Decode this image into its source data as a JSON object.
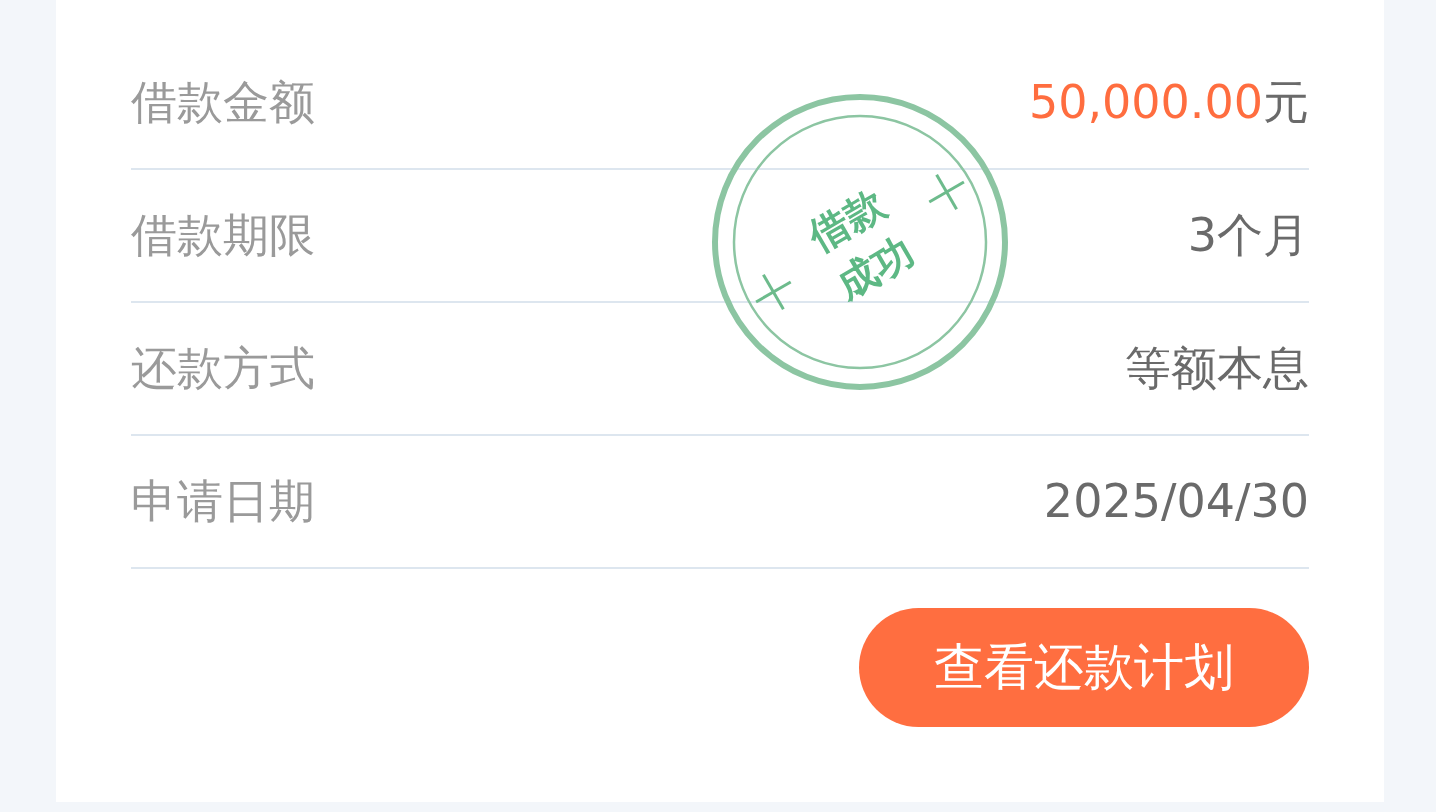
{
  "details": [
    {
      "label": "借款金额",
      "value": "50,000.00",
      "unit": "元",
      "kind": "amount"
    },
    {
      "label": "借款期限",
      "value": "3个月",
      "kind": "plain"
    },
    {
      "label": "还款方式",
      "value": "等额本息",
      "kind": "plain"
    },
    {
      "label": "申请日期",
      "value": "2025/04/30",
      "kind": "plain"
    }
  ],
  "stamp": {
    "lines": [
      "借款",
      "成功"
    ]
  },
  "button": {
    "label": "查看还款计划"
  }
}
